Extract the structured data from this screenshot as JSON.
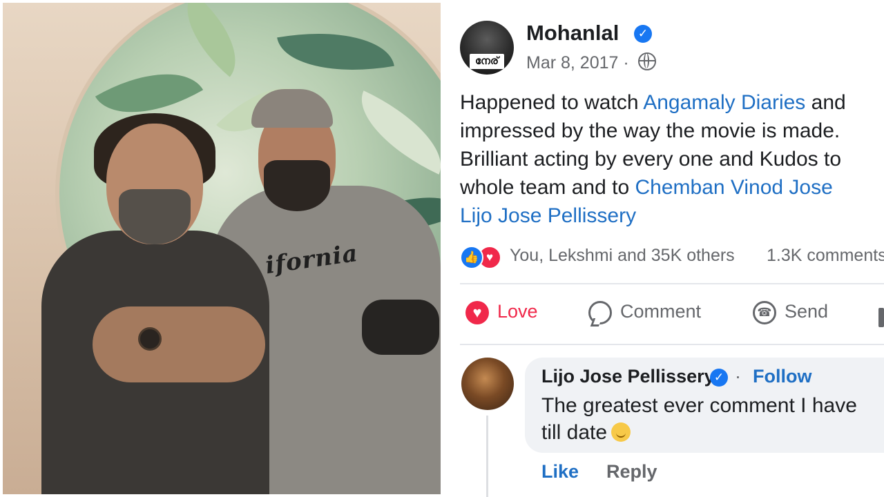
{
  "post": {
    "author": "Mohanlal",
    "avatar_badge": "നേര്",
    "date": "Mar 8, 2017 ·",
    "text": {
      "line1_pre": "Happened to watch ",
      "line1_link": "Angamaly Diaries",
      "line1_post": " and",
      "line2": "impressed by the way the movie is made.",
      "line3": "Brilliant acting by every one and Kudos to",
      "line4_pre": "whole team and to ",
      "line4_link": "Chemban Vinod Jose",
      "line5_link": "Lijo Jose Pellissery"
    },
    "reactions_text": "You, Lekshmi and 35K others",
    "comment_count": "1.3K comments",
    "actions": {
      "love": "Love",
      "comment": "Comment",
      "send": "Send"
    }
  },
  "comment": {
    "author": "Lijo Jose Pellissery",
    "separator": "·",
    "follow": "Follow",
    "line1": "The greatest ever comment I have",
    "line2": "till date",
    "like": "Like",
    "reply": "Reply"
  },
  "photo": {
    "jersey_text": "ifornia"
  },
  "colors": {
    "link_blue": "#1f6fc4",
    "verified_blue": "#1877f2",
    "love_red": "#f0284a",
    "muted_gray": "#65676b"
  }
}
